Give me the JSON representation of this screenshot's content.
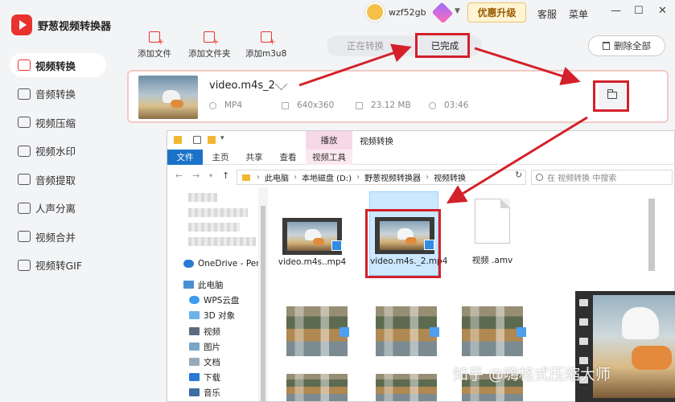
{
  "app": {
    "name": "野葱视频转换器",
    "username": "wzf52gb",
    "upgrade_label": "优惠升级",
    "support_label": "客服",
    "menu_label": "菜单",
    "minimize": "—",
    "maximize": "☐",
    "close": "✕"
  },
  "sidebar": {
    "items": [
      {
        "label": "视频转换",
        "icon": "video-convert-icon",
        "active": true
      },
      {
        "label": "音频转换",
        "icon": "audio-convert-icon",
        "active": false
      },
      {
        "label": "视频压缩",
        "icon": "video-compress-icon",
        "active": false
      },
      {
        "label": "视频水印",
        "icon": "watermark-icon",
        "active": false
      },
      {
        "label": "音频提取",
        "icon": "audio-extract-icon",
        "active": false
      },
      {
        "label": "人声分离",
        "icon": "vocal-separate-icon",
        "active": false
      },
      {
        "label": "视频合并",
        "icon": "video-merge-icon",
        "active": false
      },
      {
        "label": "视频转GIF",
        "icon": "gif-icon",
        "active": false
      }
    ]
  },
  "toolbar": {
    "add_file": "添加文件",
    "add_folder": "添加文件夹",
    "add_m3u8": "添加m3u8",
    "tab_converting": "正在转换",
    "tab_done": "已完成",
    "delete_all": "删除全部"
  },
  "file_card": {
    "name": "video.m4s_2",
    "format": "MP4",
    "resolution": "640x360",
    "size": "23.12 MB",
    "duration": "03:46"
  },
  "explorer": {
    "title": "视频转换",
    "context_tab": "播放",
    "ribbon_tabs": [
      "文件",
      "主页",
      "共享",
      "查看",
      "视频工具"
    ],
    "breadcrumb": [
      "此电脑",
      "本地磁盘 (D:)",
      "野葱视频转换器",
      "视频转换"
    ],
    "search_placeholder": "在 视频转换 中搜索",
    "tree": {
      "onedrive": "OneDrive - Perso",
      "this_pc": "此电脑",
      "items": [
        "WPS云盘",
        "3D 对象",
        "视频",
        "图片",
        "文档",
        "下载",
        "音乐"
      ]
    },
    "files": [
      {
        "name": "video.m4s..mp4",
        "type": "video",
        "selected": false
      },
      {
        "name": "video.m4s._2.mp4",
        "type": "video",
        "selected": true
      },
      {
        "name": "视频 .amv",
        "type": "document",
        "selected": false
      }
    ]
  },
  "watermark": "知乎 @嗨格式压缩大师",
  "colors": {
    "brand_red": "#e8332e",
    "highlight_red": "#d3202a",
    "explorer_blue": "#1a73c9",
    "selection": "#cce8ff",
    "upgrade_bg": "#fff4d3"
  }
}
